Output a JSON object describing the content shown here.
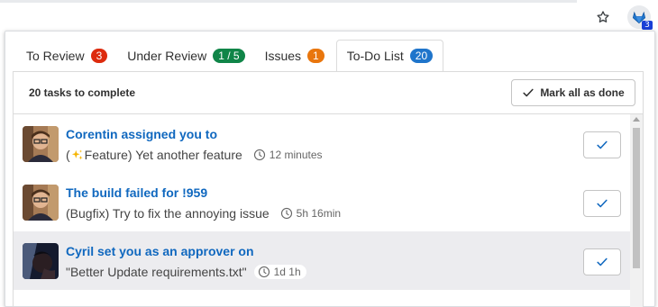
{
  "browser": {
    "star_icon": "star-outline-icon",
    "extension_icon": "gitlab-extension-icon",
    "extension_badge": "3"
  },
  "tabs": [
    {
      "label": "To Review",
      "count": "3",
      "color": "#dd2b0e"
    },
    {
      "label": "Under Review",
      "count": "1 / 5",
      "color": "#108548"
    },
    {
      "label": "Issues",
      "count": "1",
      "color": "#e9760d"
    },
    {
      "label": "To-Do List",
      "count": "20",
      "color": "#1f75cb",
      "active": true
    }
  ],
  "header": {
    "task_count": "20 tasks to complete",
    "mark_all_label": "Mark all as done"
  },
  "items": [
    {
      "title": "Corentin assigned you to",
      "sub_prefix": "(",
      "sub_icon": "sparkles-icon",
      "sub_text": " Feature) Yet another feature",
      "time": "12 minutes"
    },
    {
      "title": "The build failed for !959",
      "sub_text": "(Bugfix) Try to fix the annoying issue",
      "time": "5h 16min"
    },
    {
      "title": "Cyril set you as an approver on",
      "sub_text": "\"Better Update requirements.txt\"",
      "time": "1d 1h"
    }
  ]
}
